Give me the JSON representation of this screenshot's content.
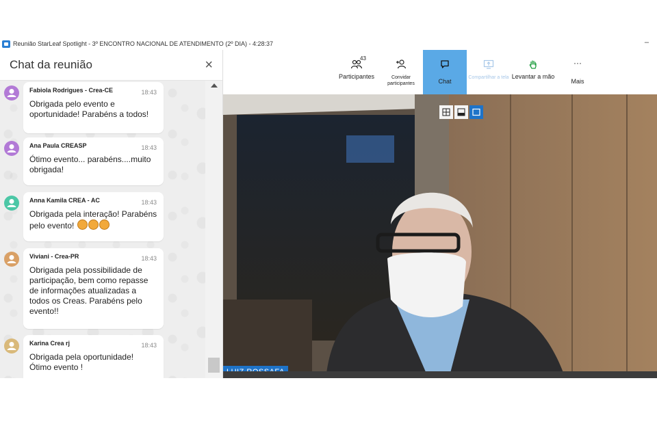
{
  "window": {
    "title": "Reunião StarLeaf Spotlight  - 3º ENCONTRO NACIONAL DE ATENDIMENTO (2º DIA) - 4:28:37",
    "minimize": "–"
  },
  "chat": {
    "title": "Chat da reunião",
    "close": "×",
    "messages": [
      {
        "sender": "Fabiola Rodrigues - Crea-CE",
        "time": "18:43",
        "text": "Obrigada pelo evento e oportunidade! Parabéns a todos!",
        "avatar_color": "#b27ad6"
      },
      {
        "sender": "Ana Paula CREASP",
        "time": "18:43",
        "text": "Ótimo evento... parabéns....muito obrigada!",
        "avatar_color": "#b27ad6"
      },
      {
        "sender": "Anna Kamila CREA - AC",
        "time": "18:43",
        "text": "Obrigada pela interação! Parabéns pelo evento!",
        "avatar_color": "#4cc7a6"
      },
      {
        "sender": "Viviani - Crea-PR",
        "time": "18:43",
        "text": "Obrigada pela possibilidade de participação, bem como repasse de informações atualizadas a todos os Creas. Parabéns pelo evento!!",
        "avatar_color": "#d9a066"
      },
      {
        "sender": "Karina Crea rj",
        "time": "18:43",
        "text": "Obrigada pela oportunidade! Ótimo evento !",
        "avatar_color": "#d9b97a"
      }
    ]
  },
  "toolbar": {
    "participants_label": "Participantes",
    "participants_count": "43",
    "invite_label": "Convidar participantes",
    "chat_label": "Chat",
    "share_label": "Compartilhar a tela",
    "raise_hand_label": "Levantar a mão",
    "more_label": "Mais",
    "more_icon": "···"
  },
  "video": {
    "speaker_name": "LUIZ ROSSAFA"
  },
  "colors": {
    "accent": "#1e73c8",
    "chat_active": "#5aa9e6"
  }
}
